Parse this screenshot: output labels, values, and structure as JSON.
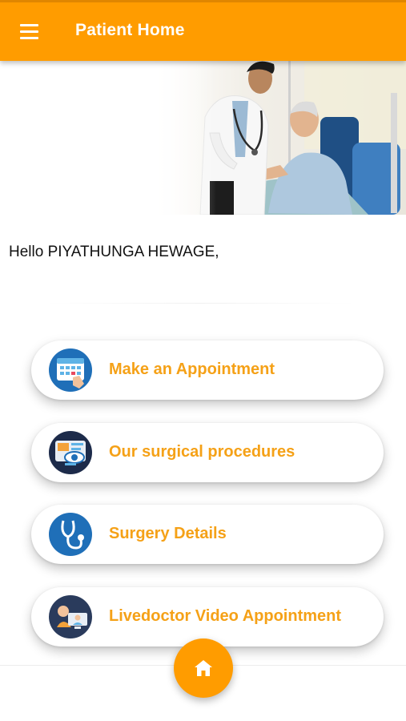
{
  "header": {
    "title": "Patient Home",
    "menu_icon": "hamburger-menu-icon",
    "color": "#ff9c00"
  },
  "hero": {
    "image": "doctor-with-elderly-patient-photo"
  },
  "greeting": {
    "text": "Hello PIYATHUNGA HEWAGE,"
  },
  "menu": {
    "accent_color": "#f5a117",
    "items": [
      {
        "label": "Make an Appointment",
        "icon": "calendar-appointment-icon"
      },
      {
        "label": "Our surgical procedures",
        "icon": "medical-monitor-eye-icon"
      },
      {
        "label": "Surgery Details",
        "icon": "stethoscope-icon"
      },
      {
        "label": "Livedoctor Video Appointment",
        "icon": "doctor-video-call-icon"
      }
    ]
  },
  "bottom_nav": {
    "home_icon": "home-icon"
  }
}
